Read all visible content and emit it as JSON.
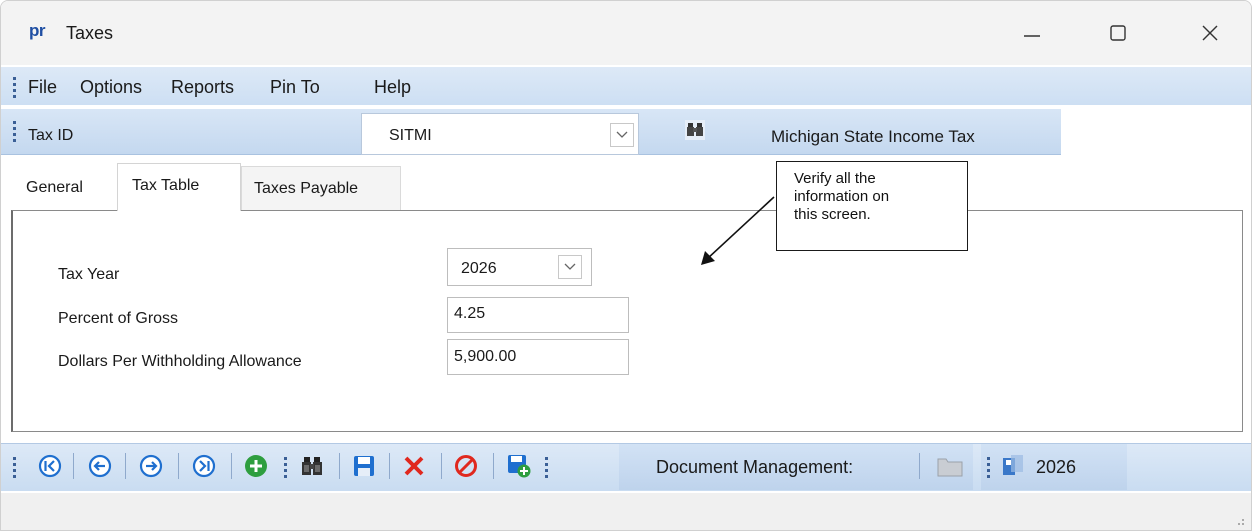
{
  "window": {
    "app_logo": "pr",
    "title": "Taxes",
    "controls": [
      "minimize-icon",
      "maximize-icon",
      "close-icon"
    ]
  },
  "menu": {
    "items": [
      "File",
      "Options",
      "Reports",
      "Pin To",
      "Help"
    ]
  },
  "tax_id_bar": {
    "label": "Tax ID",
    "value": "SITMI",
    "description": "Michigan State Income Tax"
  },
  "tabs": [
    {
      "label": "General",
      "selected": false
    },
    {
      "label": "Tax Table",
      "selected": true
    },
    {
      "label": "Taxes Payable",
      "selected": false
    }
  ],
  "tax_table": {
    "tax_year_label": "Tax Year",
    "tax_year_value": "2026",
    "percent_of_gross_label": "Percent of Gross",
    "percent_of_gross_value": "4.25",
    "dollars_per_allowance_label": "Dollars Per Withholding Allowance",
    "dollars_per_allowance_value": "5,900.00"
  },
  "callout": {
    "lines": [
      "Verify all the",
      "information on",
      "this screen."
    ]
  },
  "toolbar": {
    "icons": [
      "first-record-icon",
      "previous-record-icon",
      "next-record-icon",
      "last-record-icon",
      "add-icon",
      "find-icon",
      "save-icon",
      "delete-icon",
      "cancel-icon",
      "save-and-new-icon"
    ],
    "document_management_label": "Document Management:",
    "year": "2026"
  },
  "colors": {
    "accent_blue": "#1f6fcf",
    "delete_red": "#e0281e",
    "add_green": "#2e9e3f",
    "toolbar_bg": "#cddff3"
  }
}
